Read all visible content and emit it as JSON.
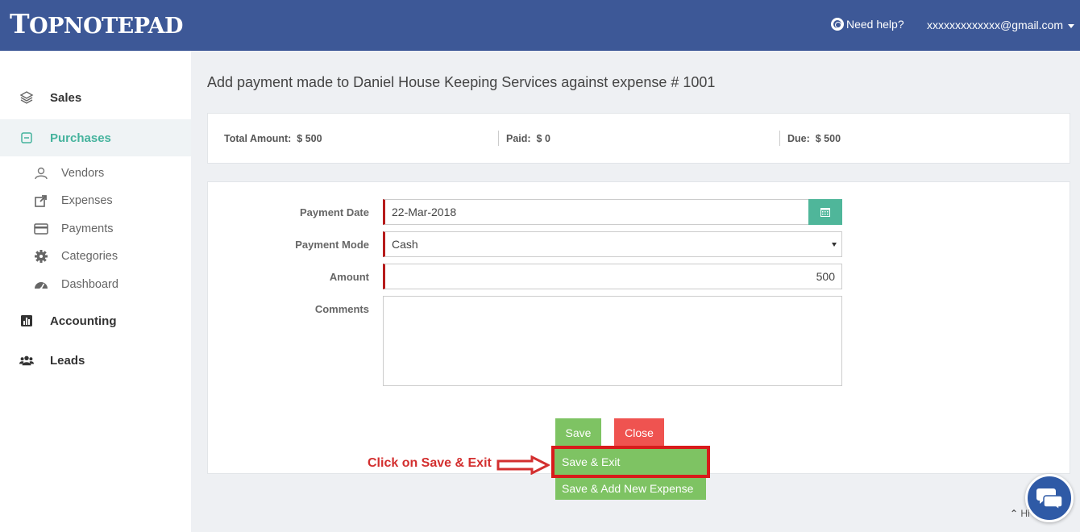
{
  "app": {
    "logo_big": "T",
    "logo_rest": "OPNOTEPAD"
  },
  "header": {
    "help_label": "Need help?",
    "user_email": "xxxxxxxxxxxxx@gmail.com"
  },
  "sidebar": {
    "main": [
      {
        "label": "Sales",
        "icon": "layers-icon"
      },
      {
        "label": "Purchases",
        "icon": "purchases-icon",
        "active": true
      },
      {
        "label": "Accounting",
        "icon": "bar-chart-icon"
      },
      {
        "label": "Leads",
        "icon": "users-icon"
      }
    ],
    "sub": [
      {
        "label": "Vendors",
        "icon": "vendor-icon"
      },
      {
        "label": "Expenses",
        "icon": "share-icon"
      },
      {
        "label": "Payments",
        "icon": "credit-card-icon"
      },
      {
        "label": "Categories",
        "icon": "gear-icon"
      },
      {
        "label": "Dashboard",
        "icon": "dashboard-icon"
      }
    ]
  },
  "page": {
    "title": "Add payment made to Daniel House Keeping Services against expense # 1001"
  },
  "summary": {
    "total_label": "Total Amount:",
    "total_value": "$ 500",
    "paid_label": "Paid:",
    "paid_value": "$ 0",
    "due_label": "Due:",
    "due_value": "$ 500"
  },
  "form": {
    "payment_date_label": "Payment Date",
    "payment_date_value": "22-Mar-2018",
    "payment_mode_label": "Payment Mode",
    "payment_mode_value": "Cash",
    "amount_label": "Amount",
    "amount_value": "500",
    "comments_label": "Comments",
    "comments_value": ""
  },
  "buttons": {
    "save": "Save",
    "close": "Close",
    "save_exit": "Save & Exit",
    "save_add_new": "Save & Add New Expense"
  },
  "annotation": {
    "text": "Click on Save & Exit"
  },
  "footer": {
    "back_to_top": "Hi"
  },
  "colors": {
    "header_bg": "#3d5897",
    "accent": "#45b39d",
    "required_marker": "#b71c1c",
    "save_green": "#7ec363",
    "close_red": "#ef5350",
    "annotation_red": "#d32f2f"
  }
}
